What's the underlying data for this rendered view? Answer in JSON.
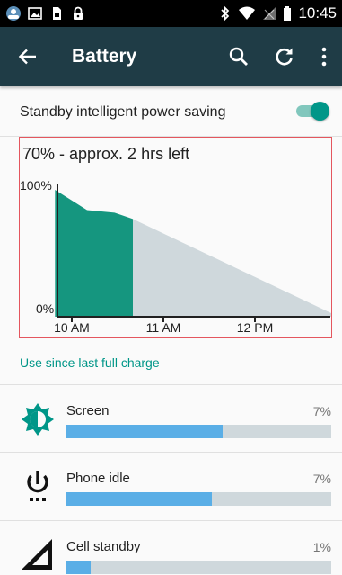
{
  "status_bar": {
    "time": "10:45"
  },
  "app_bar": {
    "title": "Battery",
    "back_icon": "arrow-back-icon",
    "search_icon": "search-icon",
    "refresh_icon": "refresh-icon",
    "overflow_icon": "more-vert-icon"
  },
  "standby": {
    "label": "Standby intelligent power saving",
    "enabled": true
  },
  "chart_data": {
    "type": "area",
    "title": "70% - approx. 2 hrs left",
    "y_tick_labels": [
      "100%",
      "0%"
    ],
    "x_tick_labels": [
      "10 AM",
      "11 AM",
      "12 PM"
    ],
    "ylim": [
      0,
      100
    ],
    "series": [
      {
        "x": [
          "09:49",
          "10:10",
          "10:28",
          "10:40"
        ],
        "values": [
          100,
          84,
          82,
          77
        ],
        "color": "#15967f"
      },
      {
        "x": [
          "10:40",
          "12:55"
        ],
        "values": [
          77,
          0
        ],
        "color": "#cfd8dc"
      }
    ]
  },
  "use_since_label": "Use since last full charge",
  "usage_items": [
    {
      "label": "Screen",
      "percent": "7%",
      "bar_fraction": 0.59,
      "icon": "brightness-icon"
    },
    {
      "label": "Phone idle",
      "percent": "7%",
      "bar_fraction": 0.55,
      "icon": "power-icon"
    },
    {
      "label": "Cell standby",
      "percent": "1%",
      "bar_fraction": 0.09,
      "icon": "signal-icon"
    }
  ],
  "colors": {
    "app_bar": "#1f3c46",
    "accent": "#009688",
    "usage_bar": "#5aaee6"
  }
}
